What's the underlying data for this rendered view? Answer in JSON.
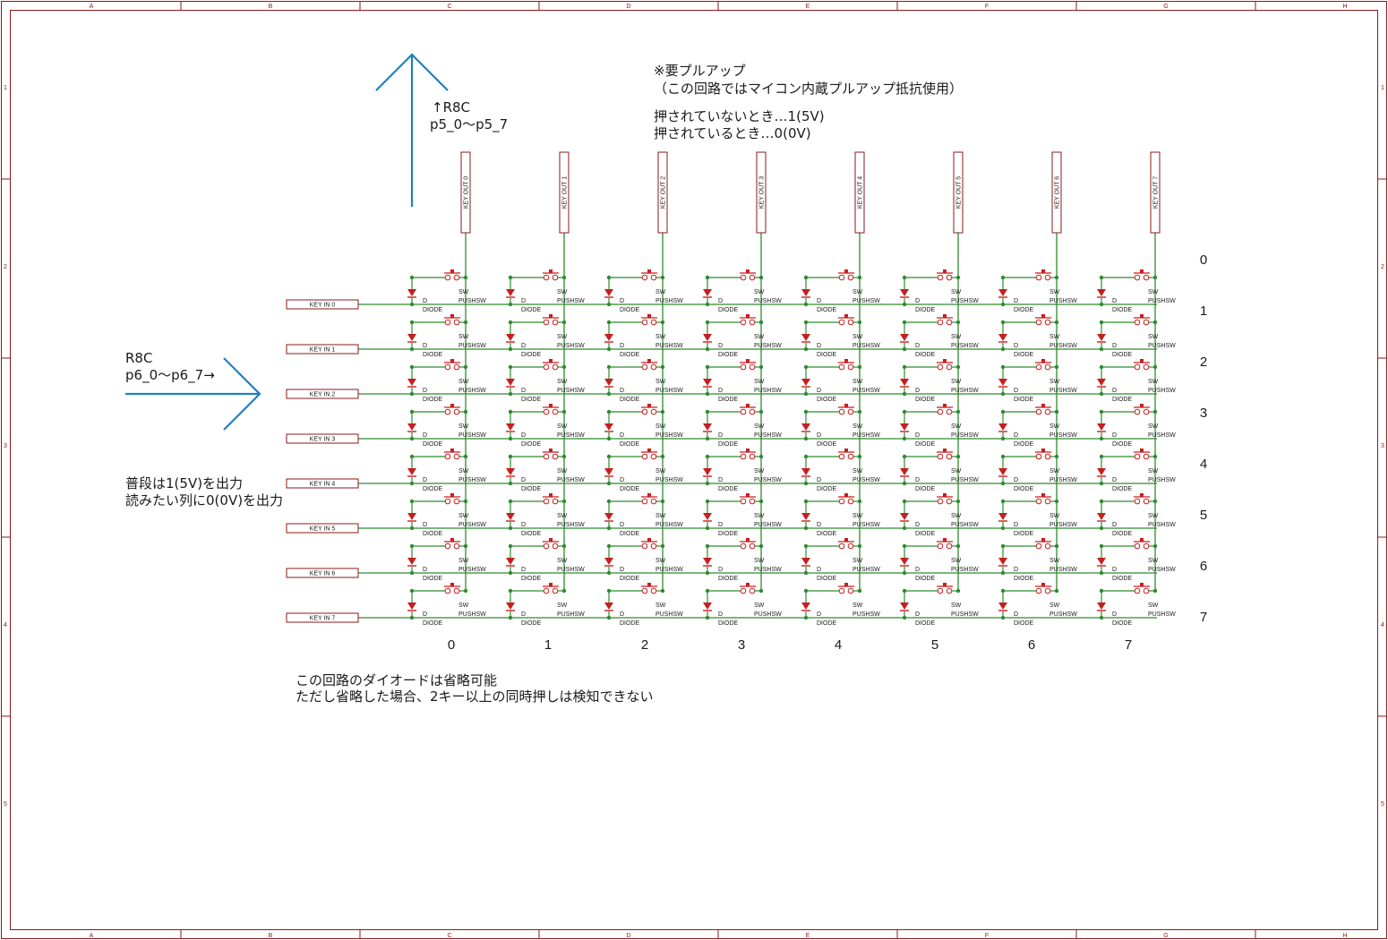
{
  "border": {
    "columns": [
      "A",
      "B",
      "C",
      "D",
      "E",
      "F",
      "G",
      "H"
    ],
    "rows": [
      "1",
      "2",
      "3",
      "4",
      "5"
    ]
  },
  "notes": {
    "pullup_line1": "※要プルアップ",
    "pullup_line2": "（この回路ではマイコン内蔵プルアップ抵抗使用）",
    "state_line1": "押されていないとき…1(5V)",
    "state_line2": "押されているとき…0(0V)",
    "r8c_out_line1": "↑R8C",
    "r8c_out_line2": "p5_0～p5_7",
    "r8c_in_line1": "R8C",
    "r8c_in_line2": "p6_0～p6_7→",
    "drive_line1": "普段は1(5V)を出力",
    "drive_line2": "読みたい列に0(0V)を出力",
    "diode_line1": "この回路のダイオードは省略可能",
    "diode_line2": "ただし省略した場合、2キー以上の同時押しは検知できない"
  },
  "matrix": {
    "key_out_labels": [
      "KEY OUT 0",
      "KEY OUT 1",
      "KEY OUT 2",
      "KEY OUT 3",
      "KEY OUT 4",
      "KEY OUT 5",
      "KEY OUT 6",
      "KEY OUT 7"
    ],
    "key_in_labels": [
      "KEY IN 0",
      "KEY IN 1",
      "KEY IN 2",
      "KEY IN 3",
      "KEY IN 4",
      "KEY IN 5",
      "KEY IN 6",
      "KEY IN 7"
    ],
    "column_numbers": [
      "0",
      "1",
      "2",
      "3",
      "4",
      "5",
      "6",
      "7"
    ],
    "row_numbers": [
      "0",
      "1",
      "2",
      "3",
      "4",
      "5",
      "6",
      "7"
    ],
    "diode_ref": "D",
    "diode_value": "DIODE",
    "switch_ref": "SW",
    "switch_value": "PUSHSW"
  },
  "colors": {
    "frame": "#8b1a1a",
    "wire": "#2e8b2e",
    "component": "#c81e1e",
    "arrow": "#1f7fc0",
    "text": "#1a1a1a"
  }
}
